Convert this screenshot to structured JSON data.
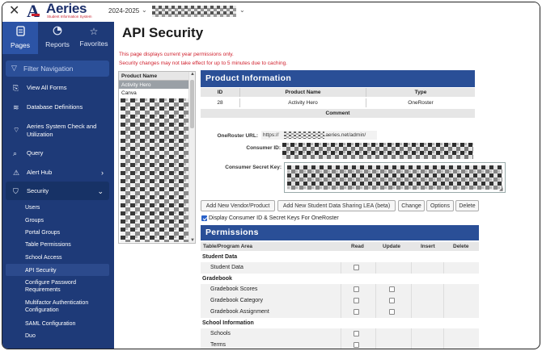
{
  "topbar": {
    "close_icon": "close-icon",
    "logo_name": "Aeries",
    "logo_tagline": "Student Information System",
    "year": "2024-2025",
    "year_chevron": "chevron-down-icon",
    "school_chevron": "chevron-down-icon"
  },
  "sidebar": {
    "tabs": [
      {
        "label": "Pages",
        "icon": "pages-icon",
        "active": true
      },
      {
        "label": "Reports",
        "icon": "reports-icon",
        "active": false
      },
      {
        "label": "Favorites",
        "icon": "star-icon",
        "active": false
      }
    ],
    "filter_placeholder": "Filter Navigation",
    "items": [
      {
        "label": "View All Forms",
        "icon": "forms-icon"
      },
      {
        "label": "Database Definitions",
        "icon": "database-icon"
      },
      {
        "label": "Aeries System Check and Utilization",
        "icon": "wifi-icon"
      },
      {
        "label": "Query",
        "icon": "query-icon"
      },
      {
        "label": "Alert Hub",
        "icon": "alert-hub-icon"
      },
      {
        "label": "Security",
        "icon": "shield-icon"
      }
    ],
    "security_subitems": [
      "Users",
      "Groups",
      "Portal Groups",
      "Table Permissions",
      "School Access",
      "API Security",
      "Configure Password Requirements",
      "Multifactor Authentication Configuration",
      "SAML Configuration",
      "Duo"
    ],
    "active_subitem": "API Security"
  },
  "main": {
    "title": "API Security",
    "warning_1": "This page displays current year permissions only.",
    "warning_2": "Security changes may not take effect for up to 5 minutes due to caching.",
    "product_list": {
      "header": "Product Name",
      "items": [
        "Activity Hero",
        "Canva"
      ],
      "selected": "Activity Hero"
    },
    "product_info": {
      "header": "Product Information",
      "columns": [
        "ID",
        "Product Name",
        "Type"
      ],
      "row": {
        "id": "28",
        "product_name": "Activity Hero",
        "type": "OneRoster"
      },
      "comment_label": "Comment",
      "oneroster_url_label": "OneRoster URL:",
      "oneroster_url_start": "https://",
      "oneroster_url_end": ".aeries.net/admin/",
      "consumer_id_label": "Consumer ID:",
      "consumer_secret_label": "Consumer Secret Key:"
    },
    "buttons": {
      "add_vendor": "Add New Vendor/Product",
      "add_lea": "Add New Student Data Sharing LEA (beta)",
      "change": "Change",
      "options": "Options",
      "delete": "Delete"
    },
    "display_keys_label": "Display Consumer ID & Secret Keys For OneRoster",
    "display_keys_checked": true,
    "permissions": {
      "header": "Permissions",
      "columns": [
        "Table/Program Area",
        "Read",
        "Update",
        "Insert",
        "Delete"
      ],
      "rows": [
        {
          "type": "group",
          "name": "Student Data"
        },
        {
          "type": "item",
          "name": "Student Data",
          "read": false,
          "update": null
        },
        {
          "type": "group",
          "name": "Gradebook"
        },
        {
          "type": "item",
          "name": "Gradebook Scores",
          "read": false,
          "update": false
        },
        {
          "type": "item",
          "name": "Gradebook Category",
          "read": false,
          "update": false
        },
        {
          "type": "item",
          "name": "Gradebook Assignment",
          "read": false,
          "update": false
        },
        {
          "type": "group",
          "name": "School Information"
        },
        {
          "type": "item",
          "name": "Schools",
          "read": false,
          "update": null
        },
        {
          "type": "item",
          "name": "Terms",
          "read": false,
          "update": null
        }
      ]
    }
  }
}
